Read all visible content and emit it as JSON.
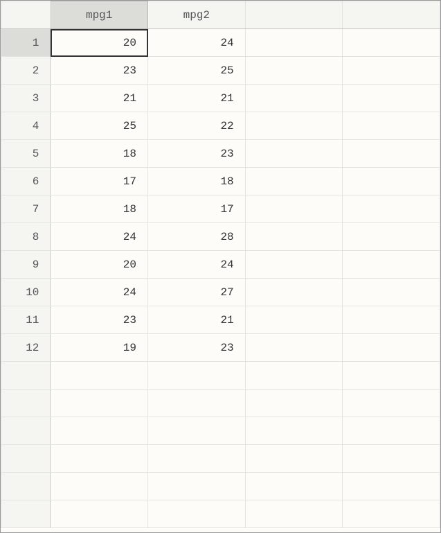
{
  "columns": [
    "mpg1",
    "mpg2"
  ],
  "empty_columns": 2,
  "rows": [
    {
      "n": 1,
      "mpg1": 20,
      "mpg2": 24
    },
    {
      "n": 2,
      "mpg1": 23,
      "mpg2": 25
    },
    {
      "n": 3,
      "mpg1": 21,
      "mpg2": 21
    },
    {
      "n": 4,
      "mpg1": 25,
      "mpg2": 22
    },
    {
      "n": 5,
      "mpg1": 18,
      "mpg2": 23
    },
    {
      "n": 6,
      "mpg1": 17,
      "mpg2": 18
    },
    {
      "n": 7,
      "mpg1": 18,
      "mpg2": 17
    },
    {
      "n": 8,
      "mpg1": 24,
      "mpg2": 28
    },
    {
      "n": 9,
      "mpg1": 20,
      "mpg2": 24
    },
    {
      "n": 10,
      "mpg1": 24,
      "mpg2": 27
    },
    {
      "n": 11,
      "mpg1": 23,
      "mpg2": 21
    },
    {
      "n": 12,
      "mpg1": 19,
      "mpg2": 23
    }
  ],
  "empty_rows": 6,
  "selected": {
    "row": 0,
    "col": 0
  }
}
